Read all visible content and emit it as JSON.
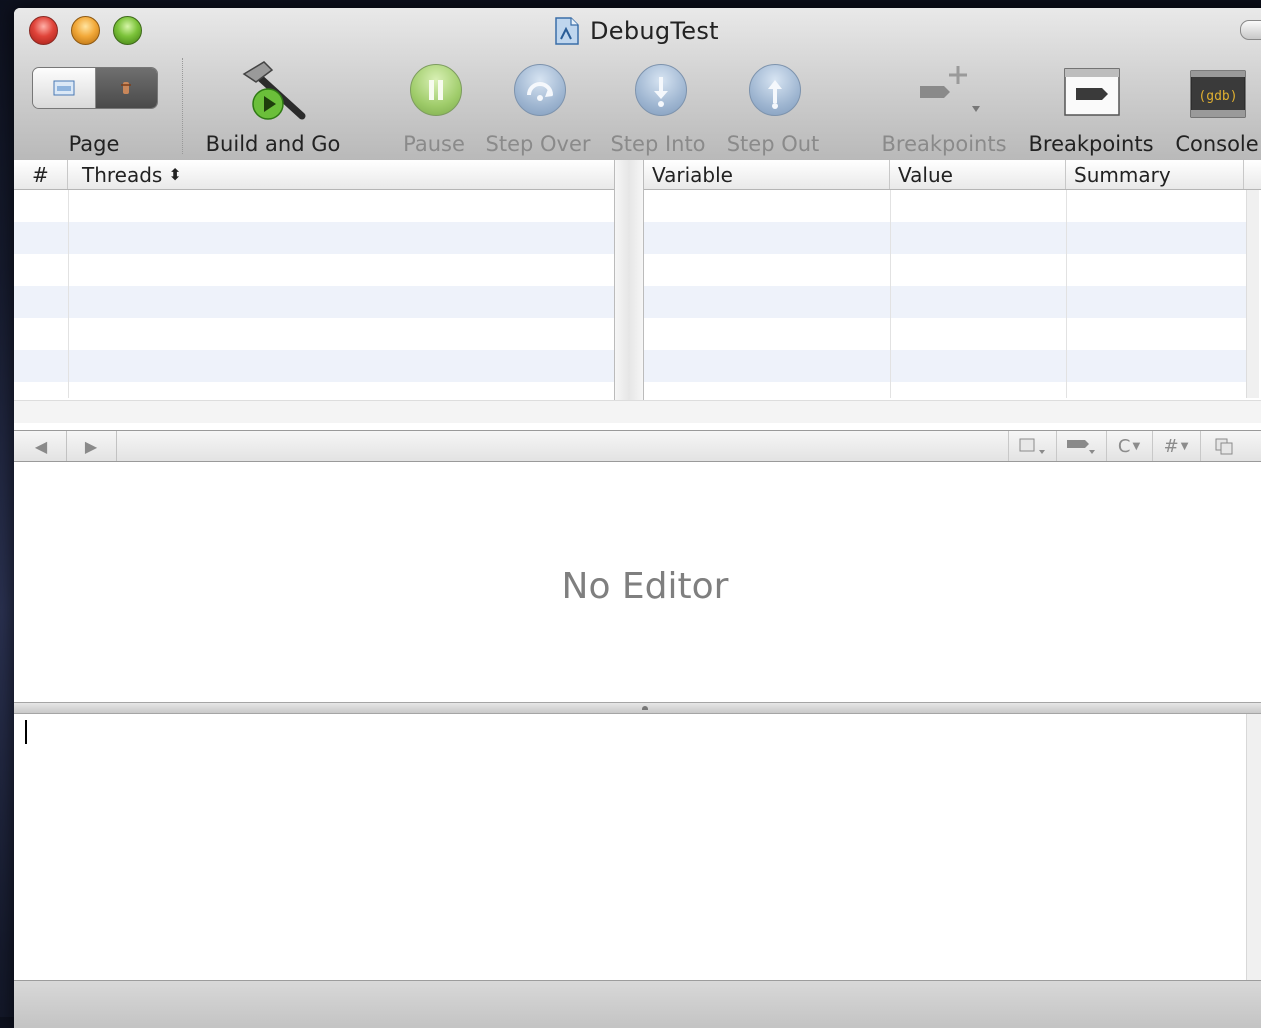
{
  "window": {
    "title": "DebugTest"
  },
  "toolbar": {
    "page_label": "Page",
    "build_label": "Build and Go",
    "pause_label": "Pause",
    "step_over_label": "Step Over",
    "step_into_label": "Step Into",
    "step_out_label": "Step Out",
    "breakpoints_add_label": "Breakpoints",
    "breakpoints_label": "Breakpoints",
    "console_label": "Console",
    "console_icon_text": "(gdb)"
  },
  "threads_table": {
    "columns": [
      "#",
      "Threads"
    ],
    "sort_glyph": "⬍"
  },
  "variables_table": {
    "columns": [
      "Variable",
      "Value",
      "Summary"
    ]
  },
  "nav": {
    "back_icon": "◀",
    "forward_icon": "▶",
    "tools": [
      "bookmarks-icon",
      "breakpoints-menu-icon",
      "C",
      "#",
      "counterpart-icon"
    ]
  },
  "editor": {
    "placeholder_text": "No Editor"
  },
  "console": {
    "content": ""
  }
}
